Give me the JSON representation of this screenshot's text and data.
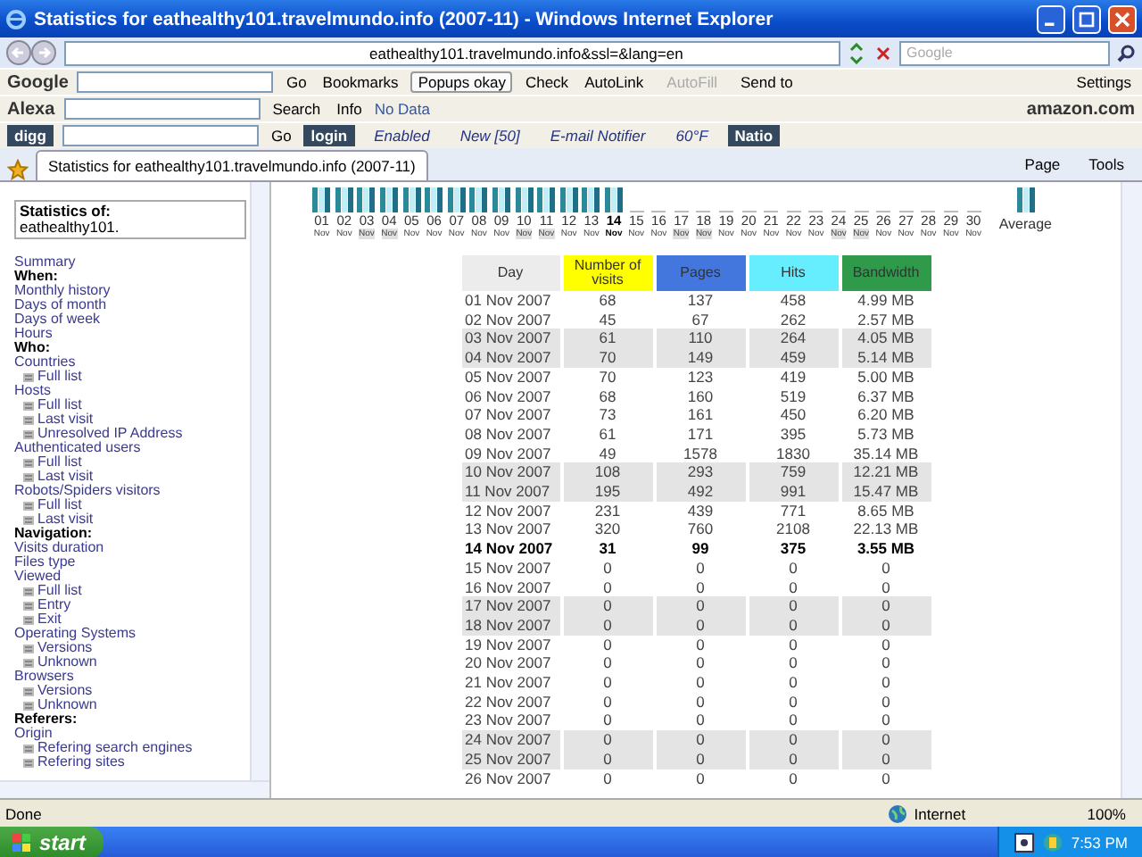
{
  "window": {
    "title": "Statistics for eathealthy101.travelmundo.info (2007-11) - Windows Internet Explorer"
  },
  "address_bar": {
    "value": "eathealthy101.travelmundo.info&ssl=&lang=en"
  },
  "search_box": {
    "placeholder": "Google"
  },
  "toolbars": [
    {
      "items": [
        {
          "kind": "logo",
          "label": "Google"
        },
        {
          "kind": "field"
        },
        {
          "kind": "button",
          "label": "Go"
        },
        {
          "kind": "button",
          "label": "Bookmarks"
        },
        {
          "kind": "framed",
          "label": "Popups okay"
        },
        {
          "kind": "button",
          "label": "Check"
        },
        {
          "kind": "button",
          "label": "AutoLink"
        },
        {
          "kind": "disabled",
          "label": "AutoFill"
        },
        {
          "kind": "button",
          "label": "Send to"
        },
        {
          "kind": "spacer"
        },
        {
          "kind": "button",
          "label": "Settings"
        }
      ]
    },
    {
      "items": [
        {
          "kind": "logo",
          "label": "Alexa"
        },
        {
          "kind": "field"
        },
        {
          "kind": "button",
          "label": "Search"
        },
        {
          "kind": "button",
          "label": "Info"
        },
        {
          "kind": "note",
          "label": "No Data"
        },
        {
          "kind": "spacer"
        },
        {
          "kind": "logo",
          "label": "amazon.com"
        }
      ]
    },
    {
      "items": [
        {
          "kind": "dark",
          "label": "digg"
        },
        {
          "kind": "field"
        },
        {
          "kind": "button",
          "label": "Go"
        },
        {
          "kind": "dark",
          "label": "login"
        },
        {
          "kind": "italic",
          "label": "Enabled"
        },
        {
          "kind": "italic",
          "label": "New [50]"
        },
        {
          "kind": "italic",
          "label": "E-mail Notifier"
        },
        {
          "kind": "italic",
          "label": "60°F"
        },
        {
          "kind": "dark",
          "label": "Natio"
        }
      ]
    }
  ],
  "tabs": [
    {
      "label": "Statistics for eathealthy101.travelmundo.info (2007-11)",
      "selected": true
    }
  ],
  "commands": [
    "Page",
    "Tools"
  ],
  "sidebar": {
    "title": "Statistics of:",
    "site": "eathealthy101.",
    "items": [
      {
        "kind": "link",
        "label": "Summary"
      },
      {
        "kind": "heading",
        "label": "When:"
      },
      {
        "kind": "link",
        "label": "Monthly history"
      },
      {
        "kind": "link",
        "label": "Days of month"
      },
      {
        "kind": "link",
        "label": "Days of week"
      },
      {
        "kind": "link",
        "label": "Hours"
      },
      {
        "kind": "heading",
        "label": "Who:"
      },
      {
        "kind": "link",
        "label": "Countries"
      },
      {
        "kind": "sub",
        "label": "Full list"
      },
      {
        "kind": "link",
        "label": "Hosts"
      },
      {
        "kind": "sub",
        "label": "Full list"
      },
      {
        "kind": "sub",
        "label": "Last visit"
      },
      {
        "kind": "sub",
        "label": "Unresolved IP Address"
      },
      {
        "kind": "link",
        "label": "Authenticated users"
      },
      {
        "kind": "sub",
        "label": "Full list"
      },
      {
        "kind": "sub",
        "label": "Last visit"
      },
      {
        "kind": "link",
        "label": "Robots/Spiders visitors"
      },
      {
        "kind": "sub",
        "label": "Full list"
      },
      {
        "kind": "sub",
        "label": "Last visit"
      },
      {
        "kind": "heading",
        "label": "Navigation:"
      },
      {
        "kind": "link",
        "label": "Visits duration"
      },
      {
        "kind": "link",
        "label": "Files type"
      },
      {
        "kind": "link",
        "label": "Viewed"
      },
      {
        "kind": "sub",
        "label": "Full list"
      },
      {
        "kind": "sub",
        "label": "Entry"
      },
      {
        "kind": "sub",
        "label": "Exit"
      },
      {
        "kind": "link",
        "label": "Operating Systems"
      },
      {
        "kind": "sub",
        "label": "Versions"
      },
      {
        "kind": "sub",
        "label": "Unknown"
      },
      {
        "kind": "link",
        "label": "Browsers"
      },
      {
        "kind": "sub",
        "label": "Versions"
      },
      {
        "kind": "sub",
        "label": "Unknown"
      },
      {
        "kind": "heading",
        "label": "Referers:"
      },
      {
        "kind": "link",
        "label": "Origin"
      },
      {
        "kind": "sub",
        "label": "Refering search engines"
      },
      {
        "kind": "sub",
        "label": "Refering sites"
      }
    ]
  },
  "days": [
    {
      "day": "01",
      "month": "Nov",
      "weekend": false,
      "current": false
    },
    {
      "day": "02",
      "month": "Nov",
      "weekend": false,
      "current": false
    },
    {
      "day": "03",
      "month": "Nov",
      "weekend": true,
      "current": false
    },
    {
      "day": "04",
      "month": "Nov",
      "weekend": true,
      "current": false
    },
    {
      "day": "05",
      "month": "Nov",
      "weekend": false,
      "current": false
    },
    {
      "day": "06",
      "month": "Nov",
      "weekend": false,
      "current": false
    },
    {
      "day": "07",
      "month": "Nov",
      "weekend": false,
      "current": false
    },
    {
      "day": "08",
      "month": "Nov",
      "weekend": false,
      "current": false
    },
    {
      "day": "09",
      "month": "Nov",
      "weekend": false,
      "current": false
    },
    {
      "day": "10",
      "month": "Nov",
      "weekend": true,
      "current": false
    },
    {
      "day": "11",
      "month": "Nov",
      "weekend": true,
      "current": false
    },
    {
      "day": "12",
      "month": "Nov",
      "weekend": false,
      "current": false
    },
    {
      "day": "13",
      "month": "Nov",
      "weekend": false,
      "current": false
    },
    {
      "day": "14",
      "month": "Nov",
      "weekend": false,
      "current": true
    },
    {
      "day": "15",
      "month": "Nov",
      "weekend": false,
      "current": false
    },
    {
      "day": "16",
      "month": "Nov",
      "weekend": false,
      "current": false
    },
    {
      "day": "17",
      "month": "Nov",
      "weekend": true,
      "current": false
    },
    {
      "day": "18",
      "month": "Nov",
      "weekend": true,
      "current": false
    },
    {
      "day": "19",
      "month": "Nov",
      "weekend": false,
      "current": false
    },
    {
      "day": "20",
      "month": "Nov",
      "weekend": false,
      "current": false
    },
    {
      "day": "21",
      "month": "Nov",
      "weekend": false,
      "current": false
    },
    {
      "day": "22",
      "month": "Nov",
      "weekend": false,
      "current": false
    },
    {
      "day": "23",
      "month": "Nov",
      "weekend": false,
      "current": false
    },
    {
      "day": "24",
      "month": "Nov",
      "weekend": true,
      "current": false
    },
    {
      "day": "25",
      "month": "Nov",
      "weekend": true,
      "current": false
    },
    {
      "day": "26",
      "month": "Nov",
      "weekend": false,
      "current": false
    },
    {
      "day": "27",
      "month": "Nov",
      "weekend": false,
      "current": false
    },
    {
      "day": "28",
      "month": "Nov",
      "weekend": false,
      "current": false
    },
    {
      "day": "29",
      "month": "Nov",
      "weekend": false,
      "current": false
    },
    {
      "day": "30",
      "month": "Nov",
      "weekend": false,
      "current": false
    }
  ],
  "average_label": "Average",
  "table": {
    "columns": [
      {
        "label": "Day",
        "color": "#ececec"
      },
      {
        "label": "Number of visits",
        "color": "#ffff00"
      },
      {
        "label": "Pages",
        "color": "#4477dd"
      },
      {
        "label": "Hits",
        "color": "#66eeff"
      },
      {
        "label": "Bandwidth",
        "color": "#2e9a4a"
      }
    ],
    "rows": [
      {
        "cells": [
          "01 Nov 2007",
          "68",
          "137",
          "458",
          "4.99 MB"
        ],
        "weekend": false,
        "current": false
      },
      {
        "cells": [
          "02 Nov 2007",
          "45",
          "67",
          "262",
          "2.57 MB"
        ],
        "weekend": false,
        "current": false
      },
      {
        "cells": [
          "03 Nov 2007",
          "61",
          "110",
          "264",
          "4.05 MB"
        ],
        "weekend": true,
        "current": false
      },
      {
        "cells": [
          "04 Nov 2007",
          "70",
          "149",
          "459",
          "5.14 MB"
        ],
        "weekend": true,
        "current": false
      },
      {
        "cells": [
          "05 Nov 2007",
          "70",
          "123",
          "419",
          "5.00 MB"
        ],
        "weekend": false,
        "current": false
      },
      {
        "cells": [
          "06 Nov 2007",
          "68",
          "160",
          "519",
          "6.37 MB"
        ],
        "weekend": false,
        "current": false
      },
      {
        "cells": [
          "07 Nov 2007",
          "73",
          "161",
          "450",
          "6.20 MB"
        ],
        "weekend": false,
        "current": false
      },
      {
        "cells": [
          "08 Nov 2007",
          "61",
          "171",
          "395",
          "5.73 MB"
        ],
        "weekend": false,
        "current": false
      },
      {
        "cells": [
          "09 Nov 2007",
          "49",
          "1578",
          "1830",
          "35.14 MB"
        ],
        "weekend": false,
        "current": false
      },
      {
        "cells": [
          "10 Nov 2007",
          "108",
          "293",
          "759",
          "12.21 MB"
        ],
        "weekend": true,
        "current": false
      },
      {
        "cells": [
          "11 Nov 2007",
          "195",
          "492",
          "991",
          "15.47 MB"
        ],
        "weekend": true,
        "current": false
      },
      {
        "cells": [
          "12 Nov 2007",
          "231",
          "439",
          "771",
          "8.65 MB"
        ],
        "weekend": false,
        "current": false
      },
      {
        "cells": [
          "13 Nov 2007",
          "320",
          "760",
          "2108",
          "22.13 MB"
        ],
        "weekend": false,
        "current": false
      },
      {
        "cells": [
          "14 Nov 2007",
          "31",
          "99",
          "375",
          "3.55 MB"
        ],
        "weekend": false,
        "current": true
      },
      {
        "cells": [
          "15 Nov 2007",
          "0",
          "0",
          "0",
          "0"
        ],
        "weekend": false,
        "current": false
      },
      {
        "cells": [
          "16 Nov 2007",
          "0",
          "0",
          "0",
          "0"
        ],
        "weekend": false,
        "current": false
      },
      {
        "cells": [
          "17 Nov 2007",
          "0",
          "0",
          "0",
          "0"
        ],
        "weekend": true,
        "current": false
      },
      {
        "cells": [
          "18 Nov 2007",
          "0",
          "0",
          "0",
          "0"
        ],
        "weekend": true,
        "current": false
      },
      {
        "cells": [
          "19 Nov 2007",
          "0",
          "0",
          "0",
          "0"
        ],
        "weekend": false,
        "current": false
      },
      {
        "cells": [
          "20 Nov 2007",
          "0",
          "0",
          "0",
          "0"
        ],
        "weekend": false,
        "current": false
      },
      {
        "cells": [
          "21 Nov 2007",
          "0",
          "0",
          "0",
          "0"
        ],
        "weekend": false,
        "current": false
      },
      {
        "cells": [
          "22 Nov 2007",
          "0",
          "0",
          "0",
          "0"
        ],
        "weekend": false,
        "current": false
      },
      {
        "cells": [
          "23 Nov 2007",
          "0",
          "0",
          "0",
          "0"
        ],
        "weekend": false,
        "current": false
      },
      {
        "cells": [
          "24 Nov 2007",
          "0",
          "0",
          "0",
          "0"
        ],
        "weekend": true,
        "current": false
      },
      {
        "cells": [
          "25 Nov 2007",
          "0",
          "0",
          "0",
          "0"
        ],
        "weekend": true,
        "current": false
      },
      {
        "cells": [
          "26 Nov 2007",
          "0",
          "0",
          "0",
          "0"
        ],
        "weekend": false,
        "current": false
      }
    ]
  },
  "status_bar": {
    "text": "Done",
    "zone": "Internet",
    "zoom": "100%"
  },
  "taskbar": {
    "start": "start",
    "clock": "7:53 PM"
  }
}
